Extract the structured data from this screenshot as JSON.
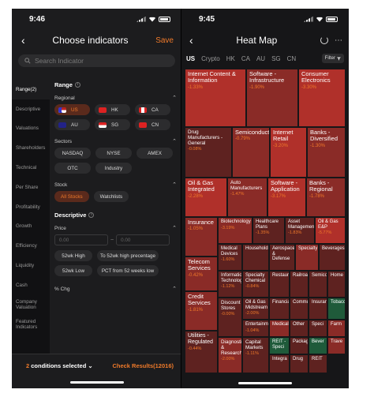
{
  "left": {
    "time": "9:46",
    "title": "Choose indicators",
    "save_label": "Save",
    "search_placeholder": "Search Indicator",
    "sidebar": [
      "Range(2)",
      "Descriptive",
      "Valuations",
      "Shareholders",
      "Technical",
      "Per Share",
      "Profitability",
      "Growth",
      "Efficiency",
      "Liquidity",
      "Cash",
      "Company Valuation",
      "Featured Indicators"
    ],
    "range_title": "Range",
    "regional_label": "Regional",
    "regions": [
      {
        "label": "US",
        "selected": true
      },
      {
        "label": "HK",
        "selected": false
      },
      {
        "label": "CA",
        "selected": false
      },
      {
        "label": "AU",
        "selected": false
      },
      {
        "label": "SG",
        "selected": false
      },
      {
        "label": "CN",
        "selected": false
      }
    ],
    "sectors_label": "Sectors",
    "sectors": [
      "NASDAQ",
      "NYSE",
      "AMEX",
      "OTC",
      "Industry"
    ],
    "stock_label": "Stock",
    "stock_options": [
      {
        "label": "All Stocks",
        "selected": true
      },
      {
        "label": "Watchlists",
        "selected": false
      }
    ],
    "descriptive_title": "Descriptive",
    "price_label": "Price",
    "price_min": "0.00",
    "price_sep": "~",
    "price_max": "0.00",
    "price_chips": [
      "52wk High",
      "To 52wk high precentage",
      "52wk Low",
      "PCT from 52 weeks low"
    ],
    "pct_chg_label": "% Chg",
    "conditions_count": "2",
    "conditions_text": "conditions selected",
    "check_results": "Check Results(12016)"
  },
  "right": {
    "time": "9:45",
    "title": "Heat Map",
    "tabs": [
      "US",
      "Crypto",
      "HK",
      "CA",
      "AU",
      "SG",
      "CN"
    ],
    "filter_label": "Filter",
    "tiles": [
      {
        "name": "Internet Content & Information",
        "value": "-1.33%"
      },
      {
        "name": "Software - Infrastructure",
        "value": "-1.90%"
      },
      {
        "name": "Consumer Electronics",
        "value": "-3.30%"
      },
      {
        "name": "Drug Manufacturers - General",
        "value": "-0.08%"
      },
      {
        "name": "Semiconductors",
        "value": "-0.79%"
      },
      {
        "name": "Internet Retail",
        "value": "-3.20%"
      },
      {
        "name": "Banks - Diversified",
        "value": "-1.30%"
      },
      {
        "name": "Oil & Gas Integrated",
        "value": "-2.28%"
      },
      {
        "name": "Auto Manufacturers",
        "value": "-1.47%"
      },
      {
        "name": "Software - Application",
        "value": "-3.17%"
      },
      {
        "name": "Banks - Regional",
        "value": "-1.78%"
      },
      {
        "name": "Insurance",
        "value": "-1.05%"
      },
      {
        "name": "Biotechnology",
        "value": "-3.19%"
      },
      {
        "name": "Healthcare Plans",
        "value": "-1.35%"
      },
      {
        "name": "Asset Management",
        "value": "-1.83%"
      },
      {
        "name": "Oil & Gas E&P",
        "value": "-5.77%"
      },
      {
        "name": "Telecom Services",
        "value": "-0.42%"
      },
      {
        "name": "Medical Devices",
        "value": "-1.60%"
      },
      {
        "name": "Household",
        "value": ""
      },
      {
        "name": "Aerospace & Defense",
        "value": ""
      },
      {
        "name": "Specialty",
        "value": ""
      },
      {
        "name": "Beverages",
        "value": ""
      },
      {
        "name": "Information Technology",
        "value": "-1.12%"
      },
      {
        "name": "Specialty Chemical",
        "value": "-0.84%"
      },
      {
        "name": "Restaurants",
        "value": ""
      },
      {
        "name": "Railroads",
        "value": ""
      },
      {
        "name": "Semiconductor",
        "value": ""
      },
      {
        "name": "Home",
        "value": ""
      },
      {
        "name": "Credit Services",
        "value": "-1.81%"
      },
      {
        "name": "Discount Stores",
        "value": "-0.00%"
      },
      {
        "name": "Oil & Gas Midstream",
        "value": "-2.00%"
      },
      {
        "name": "Financial",
        "value": ""
      },
      {
        "name": "Communication",
        "value": ""
      },
      {
        "name": "Insurance",
        "value": ""
      },
      {
        "name": "Tobacco",
        "value": ""
      },
      {
        "name": "Entertainment",
        "value": "-1.04%"
      },
      {
        "name": "Medical",
        "value": ""
      },
      {
        "name": "Other",
        "value": ""
      },
      {
        "name": "Speci",
        "value": ""
      },
      {
        "name": "Farm",
        "value": ""
      },
      {
        "name": "Utilities - Regulated",
        "value": "-0.44%"
      },
      {
        "name": "Diagnostics & Research",
        "value": "-2.00%"
      },
      {
        "name": "Capital Markets",
        "value": "-1.11%"
      },
      {
        "name": "REIT - Speci",
        "value": ""
      },
      {
        "name": "Packag",
        "value": ""
      },
      {
        "name": "Bever",
        "value": ""
      },
      {
        "name": "Trave",
        "value": ""
      },
      {
        "name": "Integra",
        "value": ""
      },
      {
        "name": "Drug",
        "value": ""
      },
      {
        "name": "REIT",
        "value": ""
      }
    ]
  },
  "colors": {
    "accent": "#f07a2a",
    "tile_dark": "#5e2220",
    "tile_mid": "#8a2b27",
    "tile_bright": "#b0302a",
    "tile_green": "#1f5a3a"
  }
}
